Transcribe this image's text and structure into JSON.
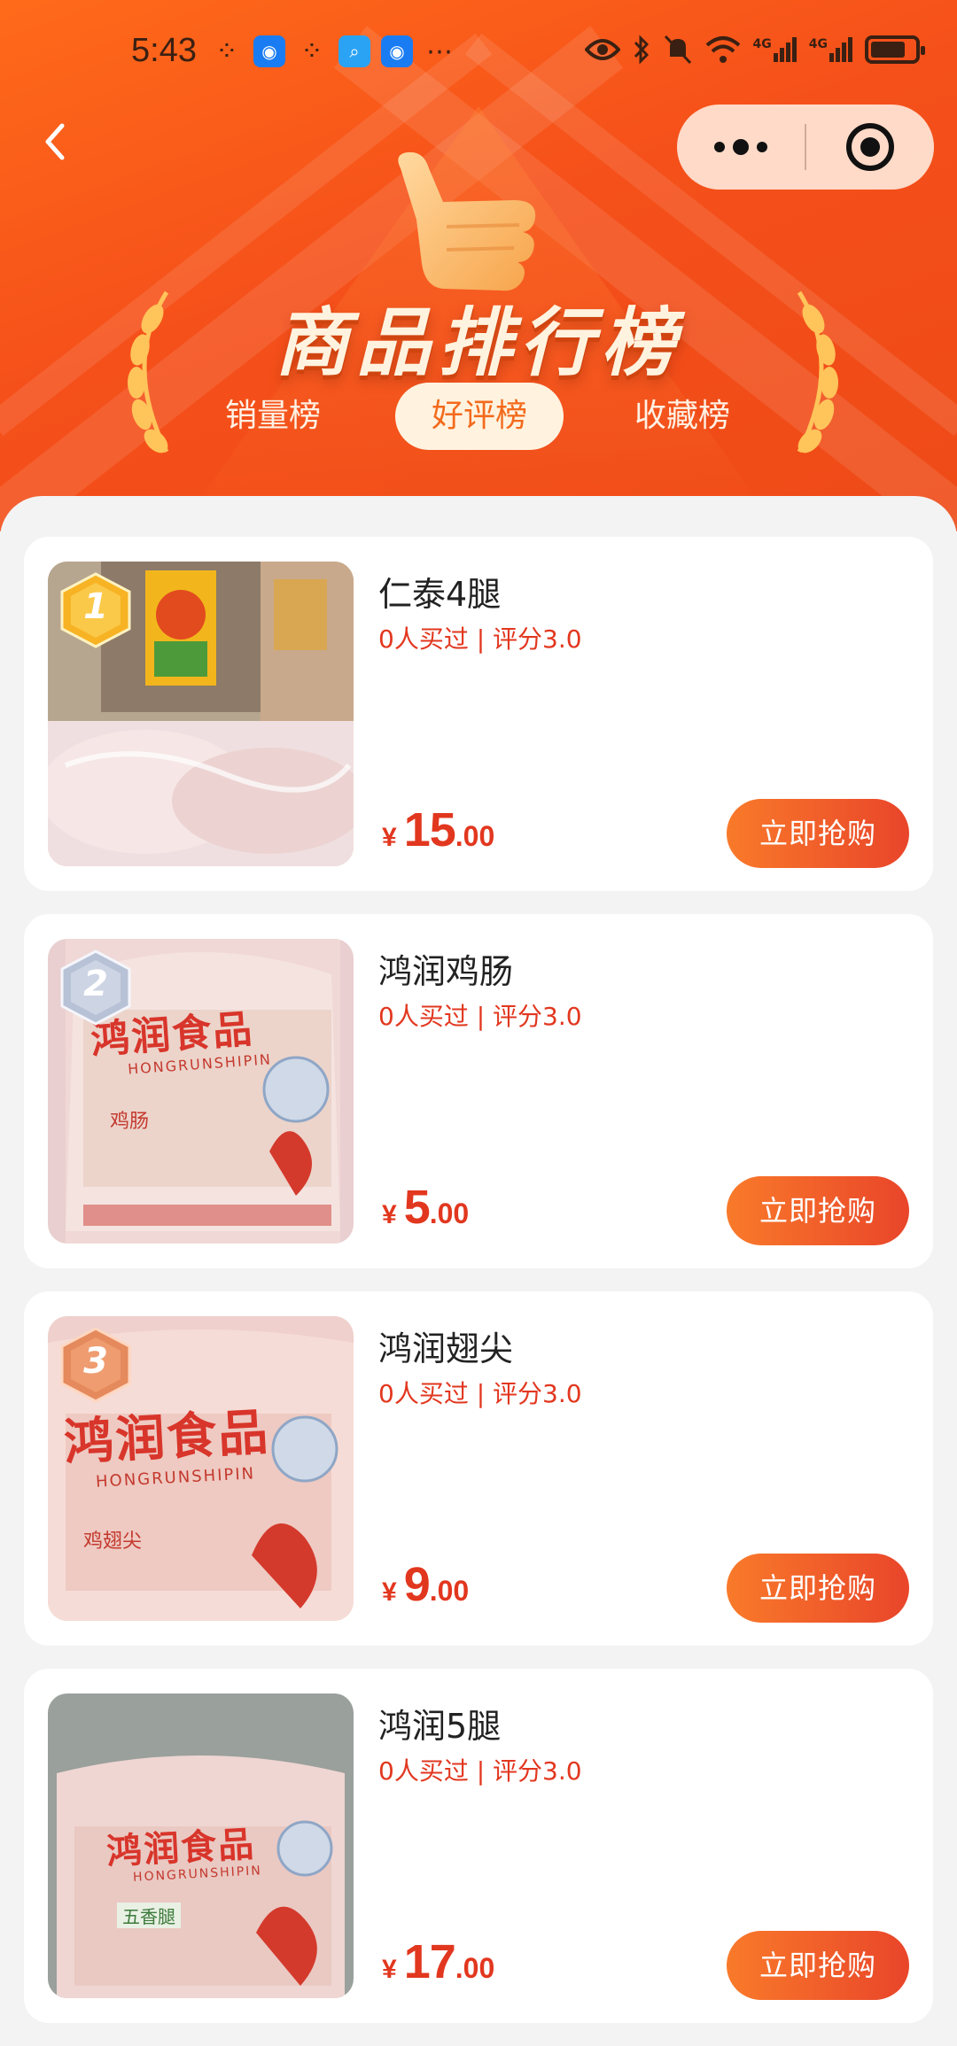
{
  "status_bar": {
    "time": "5:43",
    "network_label_1": "4G",
    "network_label_2": "4G"
  },
  "header": {
    "title": "商品排行榜",
    "tabs": [
      {
        "label": "销量榜",
        "active": false
      },
      {
        "label": "好评榜",
        "active": true
      },
      {
        "label": "收藏榜",
        "active": false
      }
    ]
  },
  "colors": {
    "header_orange": "#f5501a",
    "price_red": "#e2371f",
    "button_start": "#f97a2a",
    "button_end": "#e9452a",
    "active_tab_bg": "#fff3e0",
    "active_tab_text": "#f36a1c"
  },
  "icons": [
    "back-icon",
    "more-dots-icon",
    "close-target-icon",
    "thumbs-up-icon",
    "laurel-icon",
    "rank-badge-icon"
  ],
  "products": [
    {
      "rank": "1",
      "title": "仁泰4腿",
      "meta": "0人买过 | 评分3.0",
      "currency": "¥",
      "price_int": "15",
      "price_dec": ".00",
      "button": "立即抢购"
    },
    {
      "rank": "2",
      "title": "鸿润鸡肠",
      "meta": "0人买过 | 评分3.0",
      "currency": "¥",
      "price_int": "5",
      "price_dec": ".00",
      "button": "立即抢购"
    },
    {
      "rank": "3",
      "title": "鸿润翅尖",
      "meta": "0人买过 | 评分3.0",
      "currency": "¥",
      "price_int": "9",
      "price_dec": ".00",
      "button": "立即抢购"
    },
    {
      "rank": "",
      "title": "鸿润5腿",
      "meta": "0人买过 | 评分3.0",
      "currency": "¥",
      "price_int": "17",
      "price_dec": ".00",
      "button": "立即抢购"
    }
  ],
  "package_labels": {
    "brand": "鸿润食品",
    "brand_pinyin": "HONGRUNSHIPIN",
    "item_2": "鸡肠",
    "item_3": "鸡翅尖",
    "item_4": "五香腿"
  }
}
